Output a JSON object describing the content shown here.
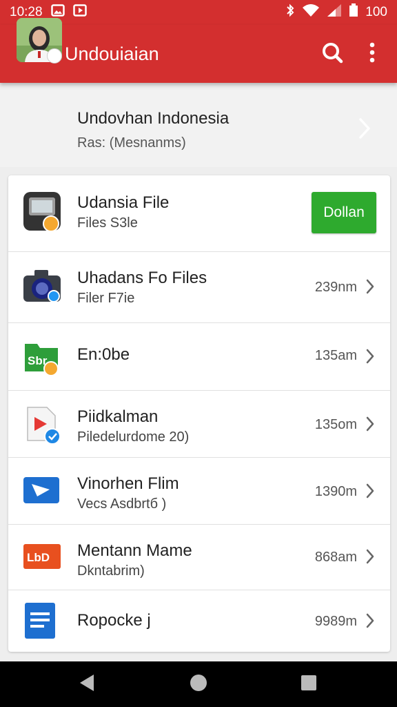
{
  "status_bar": {
    "time": "10:28",
    "battery": "100",
    "icons": [
      "image-icon",
      "youtube-icon",
      "bluetooth-icon",
      "wifi-icon",
      "signal-icon",
      "battery-icon"
    ]
  },
  "toolbar": {
    "title": "Undouiaian",
    "color": "#d32f2f",
    "icons": [
      "back-arrow-icon",
      "search-icon",
      "more-vert-icon"
    ]
  },
  "profile": {
    "name": "Undovhan Indonesia",
    "subtitle": "Ras: (Mesnanms)"
  },
  "items": [
    {
      "title": "Udansia File",
      "subtitle": "Files S3le",
      "action": "Dollan",
      "icon": "camera-app-icon"
    },
    {
      "title": "Uhadans Fo Files",
      "subtitle": "Filer F7ie",
      "size": "239nm",
      "icon": "camera-icon"
    },
    {
      "title": "En:0be",
      "subtitle": "",
      "size": "135am",
      "icon": "sbr-icon"
    },
    {
      "title": "Piidkalman",
      "subtitle": "Piledelurdome 20)",
      "size": "135om",
      "icon": "play-document-icon"
    },
    {
      "title": "Vinorhen Flim",
      "subtitle": "Vecs Asdbrtб )",
      "size": "1390m",
      "icon": "video-icon"
    },
    {
      "title": "Mentann Mame",
      "subtitle": "Dkntabrim)",
      "size": "868am",
      "icon": "lbd-icon"
    },
    {
      "title": "Ropocke j",
      "subtitle": "",
      "size": "9989m",
      "icon": "document-icon"
    }
  ],
  "accent_green": "#2eaa2e",
  "nav": [
    "back-nav-icon",
    "home-nav-icon",
    "recents-nav-icon"
  ]
}
